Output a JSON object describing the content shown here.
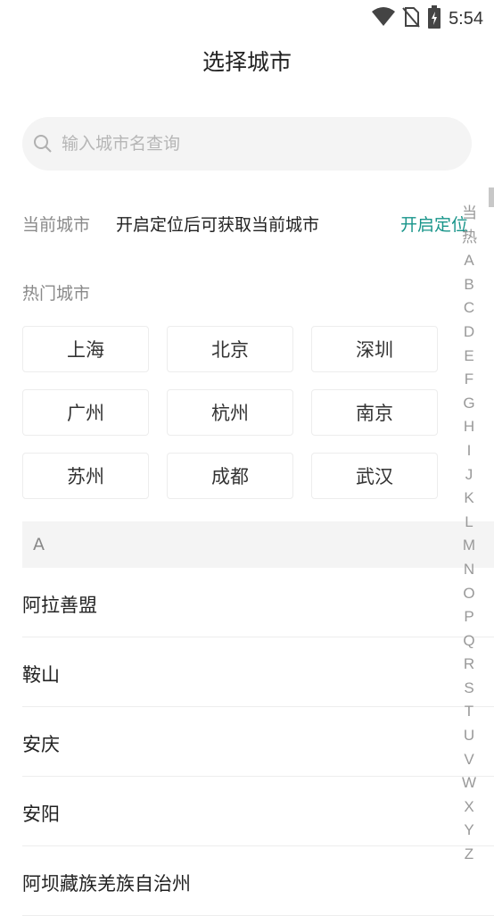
{
  "status_bar": {
    "time": "5:54",
    "icons": [
      "wifi-icon",
      "no-sim-icon",
      "battery-charging-icon"
    ]
  },
  "header": {
    "title": "选择城市"
  },
  "search": {
    "placeholder": "输入城市名查询",
    "value": ""
  },
  "current_city": {
    "label": "当前城市",
    "text": "开启定位后可获取当前城市",
    "action_label": "开启定位",
    "action_color": "#18958a"
  },
  "hot_cities": {
    "label": "热门城市",
    "items": [
      "上海",
      "北京",
      "深圳",
      "广州",
      "杭州",
      "南京",
      "苏州",
      "成都",
      "武汉"
    ]
  },
  "city_section": {
    "header": "A",
    "items": [
      "阿拉善盟",
      "鞍山",
      "安庆",
      "安阳",
      "阿坝藏族羌族自治州"
    ]
  },
  "index_bar": [
    "当",
    "热",
    "A",
    "B",
    "C",
    "D",
    "E",
    "F",
    "G",
    "H",
    "I",
    "J",
    "K",
    "L",
    "M",
    "N",
    "O",
    "P",
    "Q",
    "R",
    "S",
    "T",
    "U",
    "V",
    "W",
    "X",
    "Y",
    "Z"
  ]
}
